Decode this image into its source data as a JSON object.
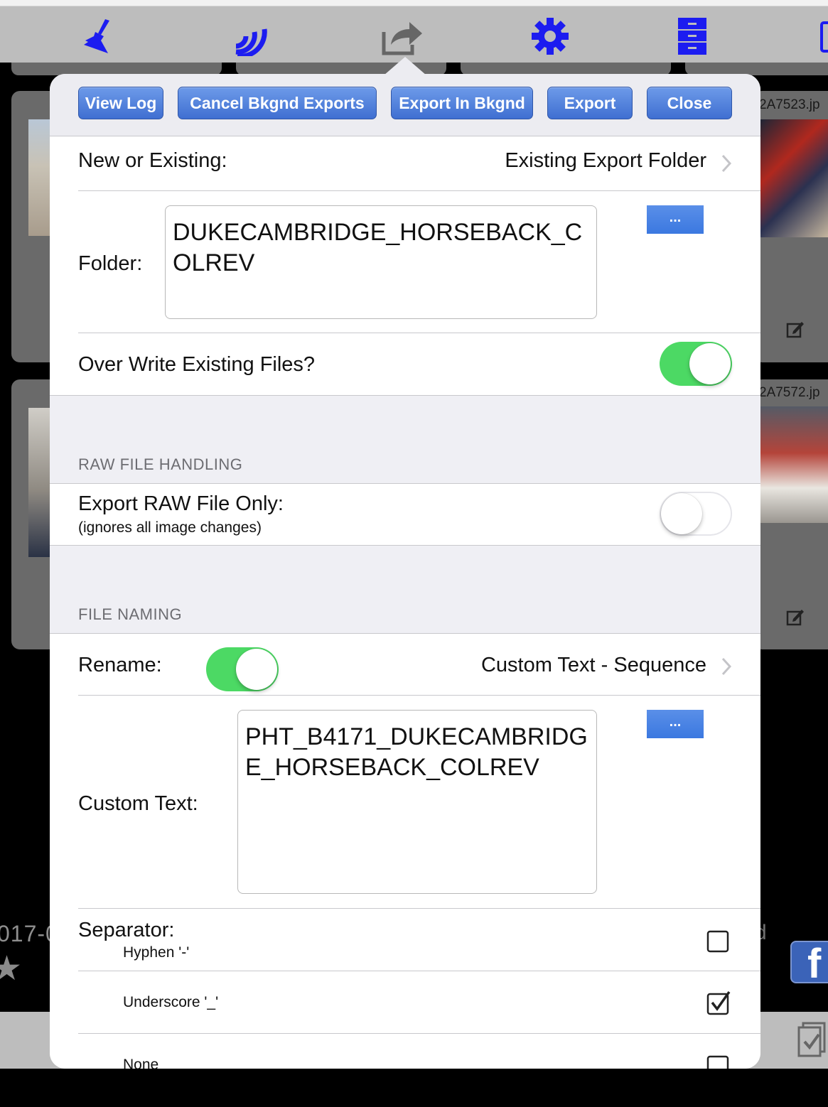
{
  "toolbar": {
    "icons": [
      "broom-icon",
      "signal-icon",
      "share-icon",
      "gear-icon",
      "file-cabinet-icon",
      "partial-icon"
    ],
    "accent": "#1c1cf0",
    "share_color": "#666666"
  },
  "background": {
    "file_top": "2A7523.jp",
    "file_bottom": "2A7572.jp",
    "date_fragment": "017-0",
    "trailing_char": "d",
    "facebook": "f"
  },
  "header_buttons": {
    "view_log": "View Log",
    "cancel_bkgnd": "Cancel Bkgnd Exports",
    "export_bkgnd": "Export In Bkgnd",
    "export": "Export",
    "close": "Close"
  },
  "new_or_existing": {
    "label": "New or Existing:",
    "value": "Existing Export Folder"
  },
  "folder": {
    "label": "Folder:",
    "value": "DUKECAMBRIDGE_HORSEBACK_COLREV",
    "browse_label": "..."
  },
  "overwrite": {
    "label": "Over Write Existing Files?",
    "on": true
  },
  "raw_section": {
    "title": "RAW FILE HANDLING",
    "export_raw_label": "Export RAW File Only:",
    "export_raw_sub": "(ignores all image changes)",
    "on": false
  },
  "naming_section": {
    "title": "FILE NAMING",
    "rename_label": "Rename:",
    "rename_on": true,
    "rename_value": "Custom Text - Sequence",
    "custom_label": "Custom Text:",
    "custom_value": "PHT_B4171_DUKECAMBRIDGE_HORSEBACK_COLREV",
    "custom_browse_label": "...",
    "separator_label": "Separator:",
    "separators": [
      {
        "label": "Hyphen '-'",
        "checked": false
      },
      {
        "label": "Underscore '_'",
        "checked": true
      },
      {
        "label": "None",
        "checked": false
      }
    ]
  },
  "colors": {
    "button_blue": "#4a7fe0",
    "toggle_green": "#4cd964",
    "section_bg": "#efeff4"
  }
}
